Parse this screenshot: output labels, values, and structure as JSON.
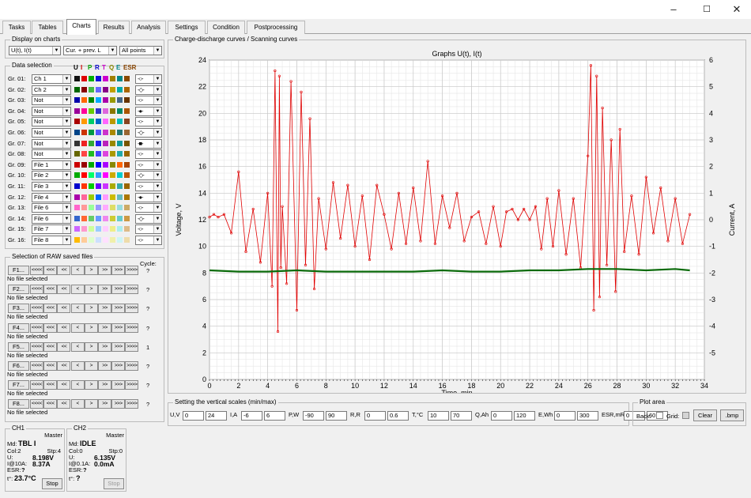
{
  "window": {
    "min_glyph": "–",
    "max_glyph": "☐",
    "close_glyph": "✕"
  },
  "tabs": [
    {
      "label": "Tasks"
    },
    {
      "label": "Tables"
    },
    {
      "label": "Charts"
    },
    {
      "label": "Results"
    },
    {
      "label": "Analysis"
    },
    {
      "label": "Settings"
    },
    {
      "label": "Condition"
    },
    {
      "label": "Postprocessing"
    }
  ],
  "display": {
    "title": "Display on charts",
    "sel1": "U(t), I(t)",
    "sel2": "Cur. + prev. L",
    "sel3": "All points"
  },
  "data_selection": {
    "title": "Data selection",
    "headers": [
      "U",
      "I",
      "P",
      "R",
      "T",
      "Q",
      "E",
      "ESR"
    ],
    "header_colors": [
      "#000000",
      "#cc0000",
      "#00a000",
      "#0000cc",
      "#cc00cc",
      "#888800",
      "#008888",
      "#884400"
    ],
    "rows": [
      {
        "label": "Gr. 01:",
        "sel": "Ch 1",
        "colors": [
          "#111111",
          "#dd0000",
          "#00b000",
          "#1010dd",
          "#cc00cc",
          "#a08000",
          "#008888",
          "#8a4a00"
        ],
        "marker": "-○-"
      },
      {
        "label": "Gr. 02:",
        "sel": "Ch 2",
        "colors": [
          "#006600",
          "#880000",
          "#44bb44",
          "#6666ff",
          "#880088",
          "#c0a000",
          "#00aaaa",
          "#aa6600"
        ],
        "marker": "-◇-"
      },
      {
        "label": "Gr. 03:",
        "sel": "Not",
        "colors": [
          "#0000aa",
          "#ff6600",
          "#008800",
          "#00aaff",
          "#aa00aa",
          "#999900",
          "#446688",
          "#663300"
        ],
        "marker": "-○-"
      },
      {
        "label": "Gr. 04:",
        "sel": "Not",
        "colors": [
          "#990099",
          "#ff0099",
          "#66cc00",
          "#3333cc",
          "#dd66dd",
          "#887700",
          "#008866",
          "#aa5500"
        ],
        "marker": "-●-"
      },
      {
        "label": "Gr. 05:",
        "sel": "Not",
        "colors": [
          "#aa0000",
          "#ff9900",
          "#00cc66",
          "#0066cc",
          "#ff66ff",
          "#bb9900",
          "#00bbbb",
          "#884422"
        ],
        "marker": "-○-"
      },
      {
        "label": "Gr. 06:",
        "sel": "Not",
        "colors": [
          "#004488",
          "#cc3300",
          "#009944",
          "#5555ff",
          "#cc33cc",
          "#aa8800",
          "#227777",
          "#996633"
        ],
        "marker": "-◇-"
      },
      {
        "label": "Gr. 07:",
        "sel": "Not",
        "colors": [
          "#333333",
          "#ee2222",
          "#33aa33",
          "#2222ee",
          "#bb22bb",
          "#998800",
          "#119999",
          "#775500"
        ],
        "marker": "-■-"
      },
      {
        "label": "Gr. 08:",
        "sel": "Not",
        "colors": [
          "#666600",
          "#ff4444",
          "#22bb22",
          "#4444ff",
          "#dd44dd",
          "#aa9900",
          "#22aaaa",
          "#996600"
        ],
        "marker": "-○-"
      },
      {
        "label": "Gr. 09:",
        "sel": "File 1",
        "colors": [
          "#cc0000",
          "#990000",
          "#00aa00",
          "#0000ff",
          "#aa00ff",
          "#888800",
          "#ff6600",
          "#aa4400"
        ],
        "marker": "-○-"
      },
      {
        "label": "Gr. 10:",
        "sel": "File 2",
        "colors": [
          "#00aa00",
          "#ff0000",
          "#00ff66",
          "#3399ff",
          "#ff00ff",
          "#ccaa00",
          "#00cccc",
          "#bb5500"
        ],
        "marker": "-◇-"
      },
      {
        "label": "Gr. 11:",
        "sel": "File 3",
        "colors": [
          "#0000cc",
          "#ff3300",
          "#00cc00",
          "#6600ff",
          "#cc33ff",
          "#aaaa00",
          "#33aaaa",
          "#996600"
        ],
        "marker": "-○-"
      },
      {
        "label": "Gr. 12:",
        "sel": "File 4",
        "colors": [
          "#aa00aa",
          "#ff6699",
          "#99cc00",
          "#0066ff",
          "#ff99ff",
          "#ccbb00",
          "#66bbbb",
          "#aa7700"
        ],
        "marker": "-●-"
      },
      {
        "label": "Gr. 13:",
        "sel": "File 6",
        "colors": [
          "#ff66cc",
          "#ff9999",
          "#99ff99",
          "#9999ff",
          "#ffaaff",
          "#dddd66",
          "#99dddd",
          "#ccaa66"
        ],
        "marker": "-○-"
      },
      {
        "label": "Gr. 14:",
        "sel": "File 6",
        "colors": [
          "#3366cc",
          "#ff6633",
          "#66cc66",
          "#6699ff",
          "#ee88ee",
          "#cccc33",
          "#66cccc",
          "#cc9944"
        ],
        "marker": "-◇-"
      },
      {
        "label": "Gr. 15:",
        "sel": "File 7",
        "colors": [
          "#cc66ff",
          "#ff99cc",
          "#ccff99",
          "#99ccff",
          "#ffccff",
          "#eeee88",
          "#aaeeee",
          "#ddbb88"
        ],
        "marker": "-○-"
      },
      {
        "label": "Gr. 16:",
        "sel": "File 8",
        "colors": [
          "#ffbb00",
          "#ffcc99",
          "#ddffcc",
          "#cce0ff",
          "#ffe0ff",
          "#f0f0aa",
          "#ccf5f5",
          "#eedcaa"
        ],
        "marker": "-○-"
      }
    ]
  },
  "raw": {
    "title": "Selection of RAW saved files",
    "cycle_label": "Cycle:",
    "nav": [
      "<<<<",
      "<<<",
      "<<",
      "<",
      ">",
      ">>",
      ">>>",
      ">>>>"
    ],
    "files": [
      {
        "btn": "F1...",
        "status": "No file selected",
        "cycle": "?"
      },
      {
        "btn": "F2...",
        "status": "No file selected",
        "cycle": "?"
      },
      {
        "btn": "F3...",
        "status": "No file selected",
        "cycle": "?"
      },
      {
        "btn": "F4...",
        "status": "No file selected",
        "cycle": "?"
      },
      {
        "btn": "F5...",
        "status": "No file selected",
        "cycle": "1"
      },
      {
        "btn": "F6...",
        "status": "No file selected",
        "cycle": "?"
      },
      {
        "btn": "F7...",
        "status": "No file selected",
        "cycle": "?"
      },
      {
        "btn": "F8...",
        "status": "No file selected",
        "cycle": "?"
      }
    ]
  },
  "ch1": {
    "title": "CH1",
    "master": "Master",
    "md_label": "Md:",
    "md_value": "TBL I",
    "col_label": "Col:2",
    "stp_label": "Stp:4",
    "u_label": "U:",
    "u_value": "8.198V",
    "i_label": "I@10A:",
    "i_value": "8.37A",
    "esr_label": "ESR:",
    "esr_value": "?",
    "t_label": "t°:",
    "t_value": "23.7°C",
    "stop": "Stop"
  },
  "ch2": {
    "title": "CH2",
    "master": "Master",
    "md_label": "Md:",
    "md_value": "IDLE",
    "col_label": "Col:0",
    "stp_label": "Stp:0",
    "u_label": "U:",
    "u_value": "6.135V",
    "i_label": "I@0.1A:",
    "i_value": "0.0mA",
    "esr_label": "ESR:",
    "esr_value": "?",
    "t_label": "t°:",
    "t_value": "?",
    "stop": "Stop"
  },
  "chart_group_title": "Charge-discharge curves / Scanning curves",
  "chart_data": {
    "type": "line",
    "title": "Graphs U(t), I(t)",
    "xlabel": "Time, min",
    "ylabel": "Voltage, V",
    "y2label": "Current, A",
    "xlim": [
      0,
      34
    ],
    "ylim": [
      0,
      24
    ],
    "y2lim": [
      -6,
      6
    ],
    "xticks": [
      0,
      2,
      4,
      6,
      8,
      10,
      12,
      14,
      16,
      18,
      20,
      22,
      24,
      26,
      28,
      30,
      32,
      34
    ],
    "yticks": [
      0,
      2,
      4,
      6,
      8,
      10,
      12,
      14,
      16,
      18,
      20,
      22,
      24
    ],
    "y2ticks": [
      -5,
      -4,
      -3,
      -2,
      -1,
      0,
      1,
      2,
      3,
      4,
      5,
      6
    ],
    "grid": true,
    "series": [
      {
        "color": "#e00000",
        "axis": "y2",
        "x": [
          0,
          0.3,
          0.6,
          1,
          1.5,
          2,
          2.5,
          3,
          3.5,
          4,
          4.3,
          4.5,
          4.7,
          4.8,
          4.9,
          5,
          5.3,
          5.6,
          6,
          6.3,
          6.6,
          6.9,
          7.2,
          7.5,
          8,
          8.5,
          9,
          9.5,
          10,
          10.5,
          11,
          11.5,
          12,
          12.5,
          13,
          13.5,
          14,
          14.5,
          15,
          15.5,
          16,
          16.5,
          17,
          17.5,
          18,
          18.5,
          19,
          19.5,
          20,
          20.4,
          20.8,
          21.2,
          21.6,
          22,
          22.4,
          22.8,
          23.2,
          23.6,
          24,
          24.5,
          25,
          25.5,
          26,
          26.2,
          26.4,
          26.6,
          26.8,
          27,
          27.3,
          27.6,
          27.9,
          28.2,
          28.5,
          29,
          29.5,
          30,
          30.5,
          31,
          31.5,
          32,
          32.5,
          33
        ],
        "y": [
          0.1,
          0.2,
          0.1,
          0.2,
          -0.5,
          1.8,
          -1.2,
          0.4,
          -1.6,
          1.0,
          -2.5,
          5.6,
          -4.2,
          5.4,
          -1.8,
          0.5,
          -2.4,
          5.2,
          -3.4,
          4.8,
          -1.7,
          3.8,
          -2.6,
          0.8,
          -1.1,
          1.4,
          -0.7,
          1.3,
          -1.0,
          0.9,
          -1.5,
          1.3,
          0.2,
          -1.1,
          1.0,
          -0.9,
          1.2,
          -0.8,
          2.2,
          -0.9,
          0.9,
          -0.3,
          1.0,
          -0.8,
          0.1,
          0.3,
          -0.9,
          0.5,
          -1.0,
          0.3,
          0.4,
          0.0,
          0.4,
          0.0,
          0.5,
          -1.1,
          0.8,
          -1.0,
          1.1,
          -1.3,
          0.8,
          -1.8,
          2.4,
          5.8,
          -3.4,
          5.4,
          -2.9,
          4.2,
          -1.7,
          3.0,
          -2.7,
          3.4,
          -1.2,
          0.9,
          -1.3,
          1.6,
          -0.5,
          1.2,
          -0.8,
          0.8,
          -0.9,
          0.2
        ]
      },
      {
        "color": "#0a6a0a",
        "axis": "y",
        "x": [
          0,
          2,
          4,
          6,
          8,
          10,
          12,
          14,
          16,
          18,
          20,
          22,
          24,
          26,
          28,
          30,
          32,
          33
        ],
        "y": [
          8.2,
          8.1,
          8.1,
          8.2,
          8.1,
          8.1,
          8.1,
          8.1,
          8.2,
          8.1,
          8.1,
          8.2,
          8.2,
          8.3,
          8.3,
          8.2,
          8.3,
          8.2
        ]
      }
    ]
  },
  "scales": {
    "title": "Setting the vertical scales (min/max)",
    "fields": [
      {
        "label": "U,V",
        "min": "0",
        "max": "24"
      },
      {
        "label": "I,A",
        "min": "-6",
        "max": "6"
      },
      {
        "label": "P,W",
        "min": "-90",
        "max": "90"
      },
      {
        "label": "R,R",
        "min": "0",
        "max": "0.6"
      },
      {
        "label": "T,°C",
        "min": "10",
        "max": "70"
      },
      {
        "label": "Q,Ah",
        "min": "0",
        "max": "120"
      },
      {
        "label": "E,Wh",
        "min": "0",
        "max": "300"
      },
      {
        "label": "ESR,mR",
        "min": "0",
        "max": "60"
      }
    ]
  },
  "plot_area": {
    "title": "Plot area",
    "back": "Back:",
    "grid": "Grid:",
    "clear": "Clear",
    "bmp": ".bmp"
  }
}
